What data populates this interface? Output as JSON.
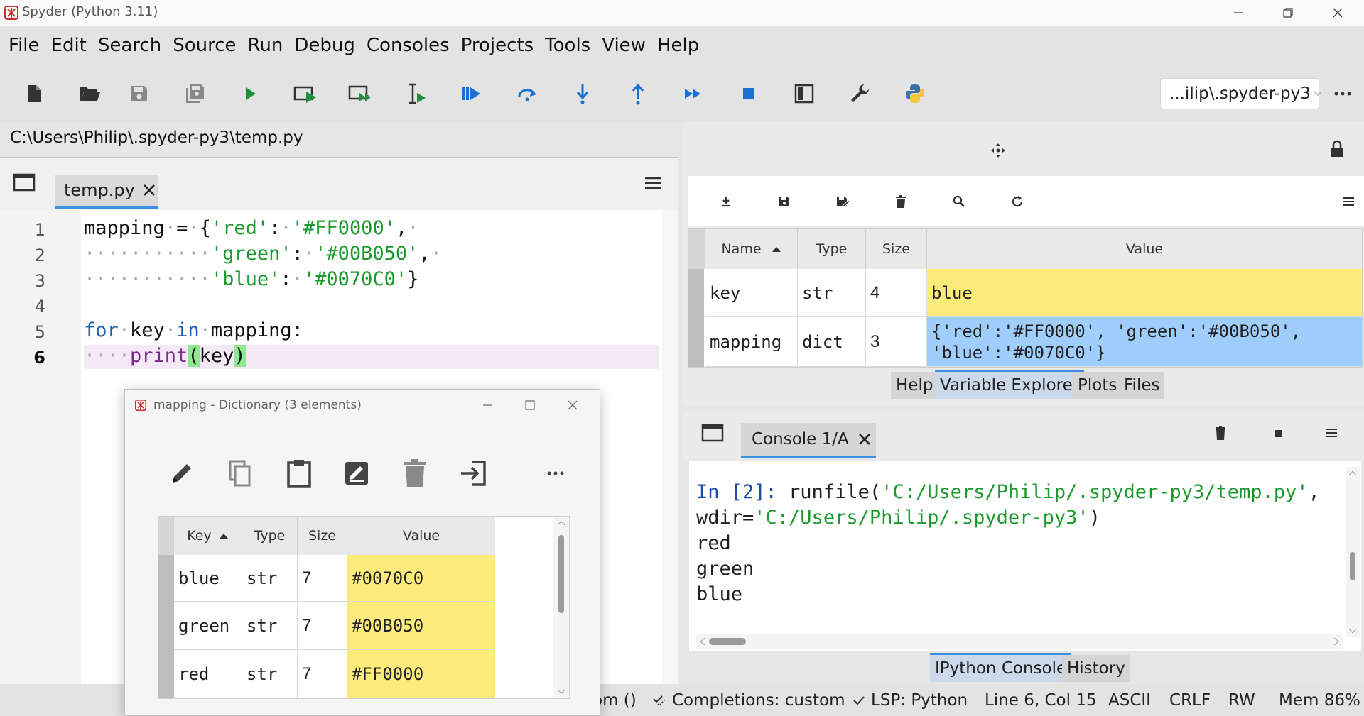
{
  "app": {
    "title": "Spyder (Python 3.11)"
  },
  "menu": [
    "File",
    "Edit",
    "Search",
    "Source",
    "Run",
    "Debug",
    "Consoles",
    "Projects",
    "Tools",
    "View",
    "Help"
  ],
  "toolbar": {
    "path_combo": "...ilip\\.spyder-py3"
  },
  "editor": {
    "filepath": "C:\\Users\\Philip\\.spyder-py3\\temp.py",
    "tab_label": "temp.py",
    "line_numbers": [
      "1",
      "2",
      "3",
      "4",
      "5",
      "6"
    ],
    "current_line": "6"
  },
  "var_explorer": {
    "headers": {
      "name": "Name",
      "type": "Type",
      "size": "Size",
      "value": "Value"
    },
    "rows": [
      {
        "name": "key",
        "type": "str",
        "size": "4",
        "value": "blue",
        "color": "#fbeb7b"
      },
      {
        "name": "mapping",
        "type": "dict",
        "size": "3",
        "value_line1": "{'red':'#FF0000', 'green':'#00B050',",
        "value_line2": "'blue':'#0070C0'}",
        "color": "#9fcdfc"
      }
    ],
    "tabs": [
      "Help",
      "Variable Explorer",
      "Plots",
      "Files"
    ],
    "active_tab": "Variable Explorer"
  },
  "console": {
    "tab_label": "Console 1/A",
    "prompt": "In [2]: ",
    "cmd_prefix": "runfile(",
    "cmd_arg1": "'C:/Users/Philip/.spyder-py3/temp.py'",
    "cmd_comma": ",",
    "wdir_prefix": "wdir=",
    "wdir_arg": "'C:/Users/Philip/.spyder-py3'",
    "wdir_close": ")",
    "output": [
      "red",
      "green",
      "blue"
    ],
    "tabs": [
      "IPython Console",
      "History"
    ],
    "active_tab": "IPython Console"
  },
  "status": {
    "partial": "om ()",
    "completions": "Completions: custom",
    "lsp": "LSP: Python",
    "position": "Line 6, Col 15",
    "encoding": "ASCII",
    "eol": "CRLF",
    "permissions": "RW",
    "memory": "Mem 86%"
  },
  "dialog": {
    "title": "mapping - Dictionary (3 elements)",
    "headers": {
      "key": "Key",
      "type": "Type",
      "size": "Size",
      "value": "Value"
    },
    "rows": [
      {
        "key": "blue",
        "type": "str",
        "size": "7",
        "value": "#0070C0"
      },
      {
        "key": "green",
        "type": "str",
        "size": "7",
        "value": "#00B050"
      },
      {
        "key": "red",
        "type": "str",
        "size": "7",
        "value": "#FF0000"
      }
    ]
  },
  "colors": {
    "accent": "#3c8ee0",
    "run_green": "#1f8f3a",
    "debug_blue": "#1a6fd1",
    "highlight_yellow": "#fbeb7b",
    "highlight_blue": "#9fcdfc"
  }
}
